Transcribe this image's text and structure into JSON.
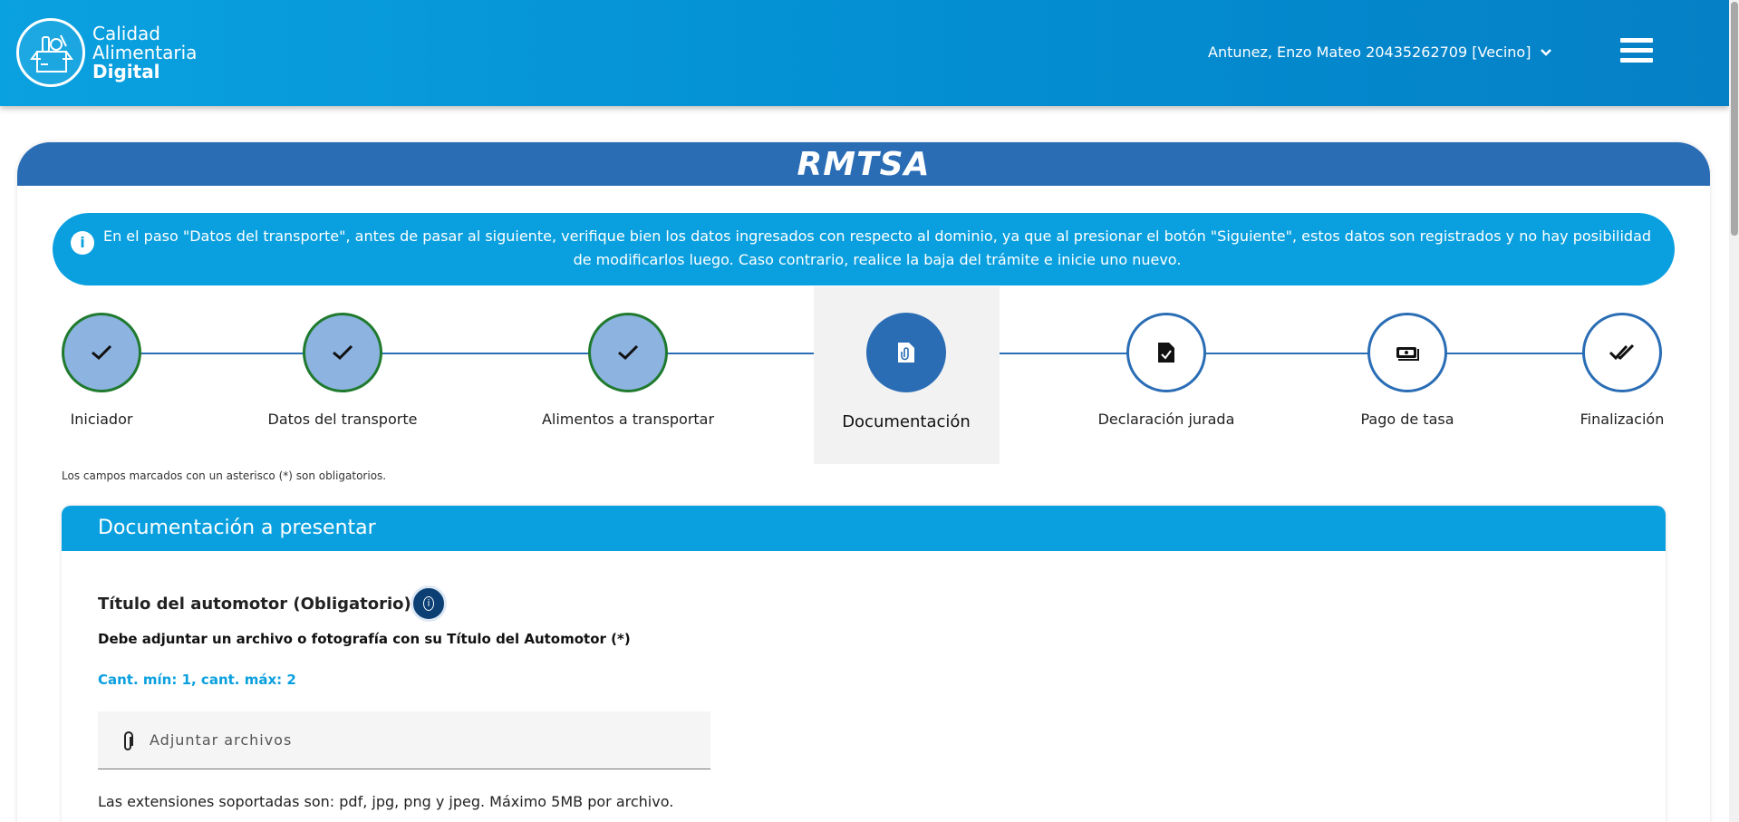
{
  "header": {
    "logo_lines": [
      "Calidad",
      "Alimentaria",
      "Digital"
    ],
    "user_label": "Antunez, Enzo Mateo 20435262709 [Vecino]",
    "menu_icon": "hamburger-icon"
  },
  "card": {
    "title": "RMTSA"
  },
  "banner": {
    "icon": "info-icon",
    "text": "En el paso \"Datos del transporte\", antes de pasar al siguiente, verifique bien los datos ingresados con respecto al dominio, ya que al presionar el botón \"Siguiente\", estos datos son registrados y no hay posibilidad de modificarlos luego. Caso contrario, realice la baja del trámite e inicie uno nuevo."
  },
  "stepper": {
    "steps": [
      {
        "label": "Iniciador",
        "state": "done",
        "icon": "check-icon"
      },
      {
        "label": "Datos del transporte",
        "state": "done",
        "icon": "check-icon"
      },
      {
        "label": "Alimentos a transportar",
        "state": "done",
        "icon": "check-icon"
      },
      {
        "label": "Documentación",
        "state": "current",
        "icon": "document-attach-icon"
      },
      {
        "label": "Declaración jurada",
        "state": "todo",
        "icon": "document-check-icon"
      },
      {
        "label": "Pago de tasa",
        "state": "todo",
        "icon": "money-icon"
      },
      {
        "label": "Finalización",
        "state": "todo",
        "icon": "double-check-icon"
      }
    ]
  },
  "note": "Los campos marcados con un asterisco (*) son obligatorios.",
  "section": {
    "title": "Documentación a presentar",
    "doc_title": "Título del automotor (Obligatorio)",
    "doc_subtitle": "Debe adjuntar un archivo o fotografía con su Título del Automotor (*)",
    "doc_qty": "Cant. mín: 1, cant. máx: 2",
    "attach_label": "Adjuntar archivos",
    "extensions": "Las extensiones soportadas son: pdf, jpg, png y jpeg. Máximo 5MB por archivo."
  },
  "colors": {
    "header_blue": "#0490d3",
    "card_head_blue": "#2a6db5",
    "banner_blue": "#0aa0df",
    "done_fill": "#8db3e0",
    "done_border": "#1f7a2e"
  }
}
